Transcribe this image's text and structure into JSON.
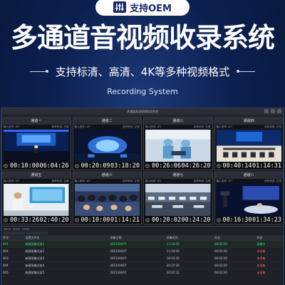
{
  "banner": {
    "oem_label": "支持OEM",
    "title": "多通道音视频收录系统",
    "subtitle": "支持标清、高清、4K等多种视频格式",
    "english": "Recording System"
  },
  "app": {
    "window_title": "多通道高清视频收录系统",
    "cell_sub_left": "输入信号: ATI",
    "cell_sub_right": "信号状态: 正常",
    "channels": [
      {
        "name": "通道一",
        "start": "00:10:00",
        "end": "06:04:26",
        "scene": "stage"
      },
      {
        "name": "通道二",
        "start": "00:20:09",
        "end": "03:18:20",
        "scene": "expo"
      },
      {
        "name": "通道三",
        "start": "00:26:06",
        "end": "04:26:20",
        "scene": "surgery"
      },
      {
        "name": "通道四",
        "start": "00:40:14",
        "end": "01:14:31",
        "scene": "conference"
      },
      {
        "name": "通道五",
        "start": "00:33:26",
        "end": "02:40:20",
        "scene": "classroom"
      },
      {
        "name": "通道六",
        "start": "00:10:00",
        "end": "01:14:21",
        "scene": "audience"
      },
      {
        "name": "通道七",
        "start": "00:20:02",
        "end": "00:24:20",
        "scene": "hall"
      },
      {
        "name": "通道八",
        "start": "00:16:30",
        "end": "01:34:23",
        "scene": "studio"
      }
    ],
    "file_table": {
      "headers": [
        "序号",
        "设置文件名",
        "采集日期",
        "采集时间",
        "时长",
        "状态"
      ],
      "rows": [
        [
          "001",
          "新建采集任务1",
          "2021/04/07",
          "11:10:00",
          "00:02:00",
          "采集中"
        ],
        [
          "002",
          "新建采集任务2",
          "2021/04/07",
          "11:10:00",
          "00:02:00",
          "未采集"
        ],
        [
          "003",
          "新建采集任务3",
          "2021/04/07",
          "18:33:30",
          "00:02:00",
          "未采集"
        ],
        [
          "004",
          "新建采集任务4",
          "2021/04/07",
          "20:37:20",
          "00:02:00",
          "未采集"
        ],
        [
          "005",
          "新建采集任务5",
          "2021/04/07",
          "20:37:22",
          "00:02:00",
          "未采集"
        ]
      ]
    }
  },
  "colors": {
    "background": "#0c2050",
    "selected_row": "#2ff07a",
    "status_pending": "#ff6a3d"
  }
}
